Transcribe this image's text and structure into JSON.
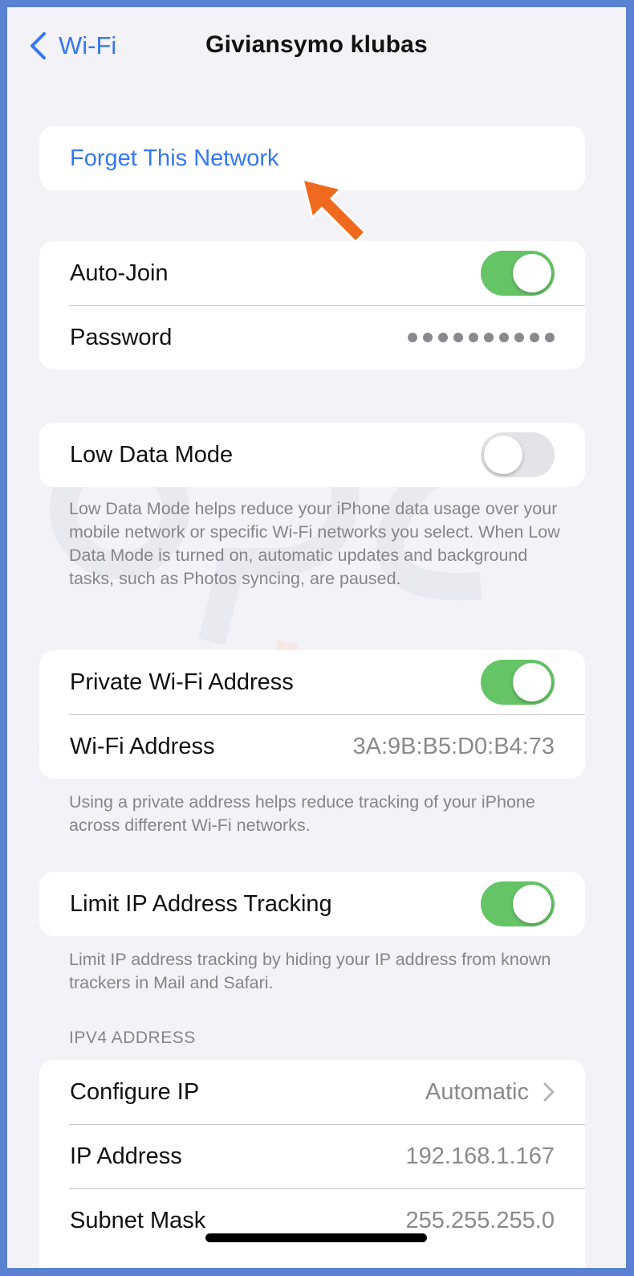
{
  "nav": {
    "back_label": "Wi-Fi",
    "title": "Giviansymo klubas"
  },
  "forget": {
    "label": "Forget This Network"
  },
  "group1": {
    "auto_join": {
      "label": "Auto-Join",
      "on": true
    },
    "password": {
      "label": "Password",
      "masked_length": 10
    }
  },
  "low_data": {
    "label": "Low Data Mode",
    "on": false,
    "footnote": "Low Data Mode helps reduce your iPhone data usage over your mobile network or specific Wi-Fi networks you select. When Low Data Mode is turned on, automatic updates and background tasks, such as Photos syncing, are paused."
  },
  "private_group": {
    "private_address": {
      "label": "Private Wi-Fi Address",
      "on": true
    },
    "wifi_address": {
      "label": "Wi-Fi Address",
      "value": "3A:9B:B5:D0:B4:73"
    },
    "footnote": "Using a private address helps reduce tracking of your iPhone across different Wi-Fi networks."
  },
  "limit_ip": {
    "label": "Limit IP Address Tracking",
    "on": true,
    "footnote": "Limit IP address tracking by hiding your IP address from known trackers in Mail and Safari."
  },
  "ipv4": {
    "header": "IPV4 ADDRESS",
    "configure_ip": {
      "label": "Configure IP",
      "value": "Automatic"
    },
    "ip_address": {
      "label": "IP Address",
      "value": "192.168.1.167"
    },
    "subnet_mask": {
      "label": "Subnet Mask",
      "value": "255.255.255.0"
    }
  },
  "colors": {
    "accent": "#3478f6",
    "toggle_on": "#65c466",
    "toggle_off": "#e3e3e8",
    "frame": "#5b82d2",
    "annotation_arrow": "#ef6a1f"
  },
  "icons": {
    "back": "chevron-left-icon",
    "disclosure": "chevron-right-icon",
    "annotation": "pointer-arrow-icon"
  }
}
